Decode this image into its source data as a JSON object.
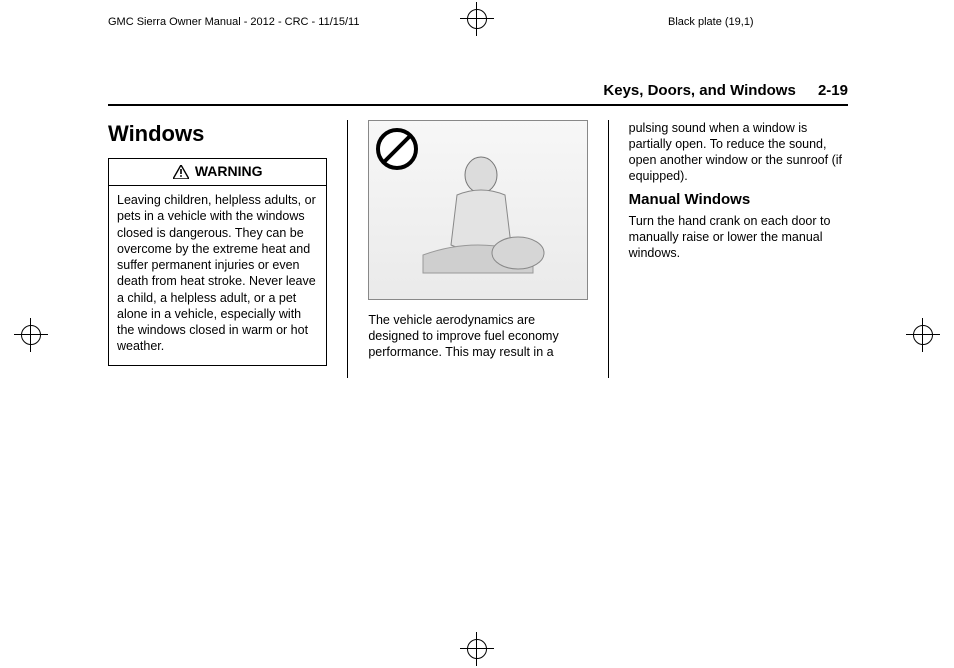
{
  "meta": {
    "header_left": "GMC Sierra Owner Manual - 2012 - CRC - 11/15/11",
    "header_right": "Black plate (19,1)"
  },
  "running_head": {
    "section_title": "Keys, Doors, and Windows",
    "page_num": "2-19"
  },
  "col1": {
    "heading": "Windows",
    "warning_label": "WARNING",
    "warning_body": "Leaving children, helpless adults, or pets in a vehicle with the windows closed is dangerous. They can be overcome by the extreme heat and suffer permanent injuries or even death from heat stroke. Never leave a child, a helpless adult, or a pet alone in a vehicle, especially with the windows closed in warm or hot weather."
  },
  "col2": {
    "illustration_alt": "Illustration: child seated in vehicle cabin with prohibition symbol",
    "caption": "The vehicle aerodynamics are designed to improve fuel economy performance. This may result in a"
  },
  "col3": {
    "continuation": "pulsing sound when a window is partially open. To reduce the sound, open another window or the sunroof (if equipped).",
    "subheading": "Manual Windows",
    "subbody": "Turn the hand crank on each door to manually raise or lower the manual windows."
  }
}
